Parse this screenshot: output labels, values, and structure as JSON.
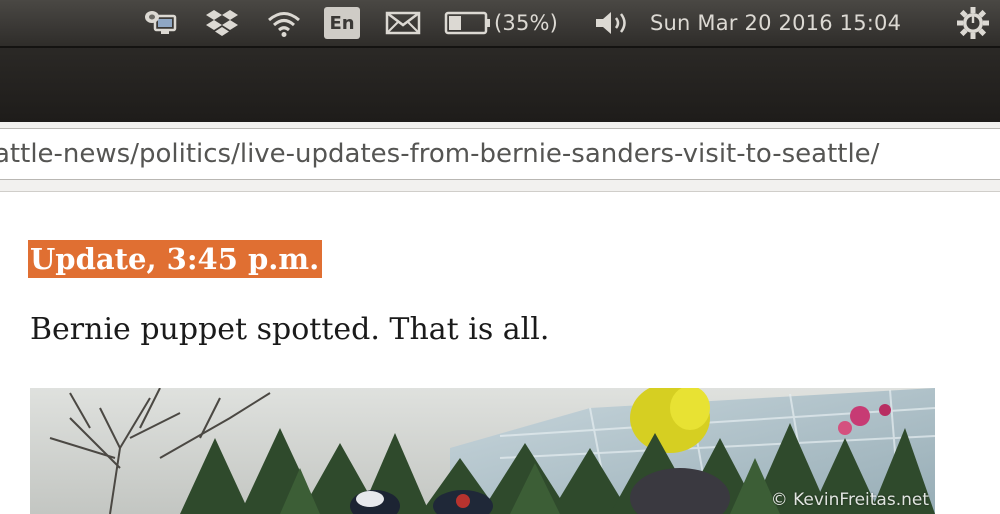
{
  "system_panel": {
    "indicators": [
      {
        "id": "network-manager",
        "icon": "network-monitor-icon"
      },
      {
        "id": "dropbox",
        "icon": "dropbox-icon"
      },
      {
        "id": "wifi",
        "icon": "wifi-icon"
      },
      {
        "id": "keyboard",
        "label": "En"
      },
      {
        "id": "mail",
        "icon": "mail-icon"
      },
      {
        "id": "battery",
        "icon": "battery-icon",
        "label": "(35%)",
        "level": 0.35
      },
      {
        "id": "sound",
        "icon": "speaker-icon"
      },
      {
        "id": "clock",
        "label": "Sun Mar 20 2016 15:04"
      },
      {
        "id": "session",
        "icon": "gear-power-icon"
      }
    ]
  },
  "browser": {
    "url": "attle-news/politics/live-updates-from-bernie-sanders-visit-to-seattle/"
  },
  "article": {
    "update_time": "Update, 3:45 p.m.",
    "update_text": "Bernie puppet spotted. That is all.",
    "photo_watermark": "© KevinFreitas.net"
  },
  "colors": {
    "panel_bg": "#3b3936",
    "chrome_bg": "#1e1c1a",
    "update_badge": "#e06f32",
    "body_text": "#1a1a1a"
  }
}
